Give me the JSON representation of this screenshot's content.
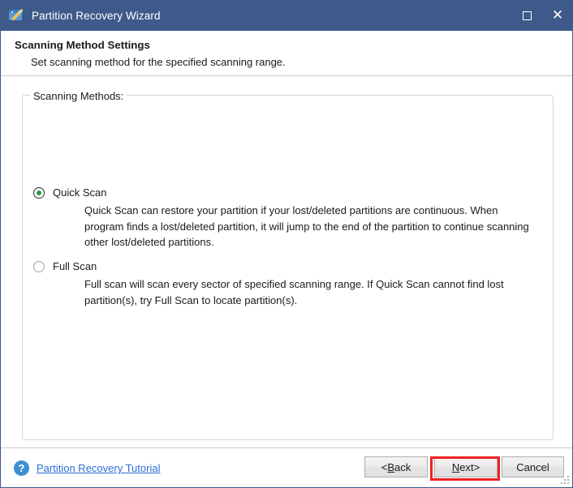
{
  "window": {
    "title": "Partition Recovery Wizard",
    "app_icon": "wizard-wand-icon",
    "titlebar_color": "#3d5a8a",
    "controls": {
      "maximize_label": "Maximize",
      "close_label": "Close"
    }
  },
  "header": {
    "title": "Scanning Method Settings",
    "subtitle": "Set scanning method for the specified scanning range."
  },
  "group": {
    "legend": "Scanning Methods:",
    "options": [
      {
        "label": "Quick Scan",
        "selected": true,
        "description": "Quick Scan can restore your partition if your lost/deleted partitions are continuous. When program finds a lost/deleted partition, it will jump to the end of the partition to continue scanning other lost/deleted partitions."
      },
      {
        "label": "Full Scan",
        "selected": false,
        "description": "Full scan will scan every sector of specified scanning range. If Quick Scan cannot find lost partition(s), try Full Scan to locate partition(s)."
      }
    ],
    "selected_accent_color": "#23a03c"
  },
  "footer": {
    "help_icon": "question-mark-icon",
    "tutorial_link": "Partition Recovery Tutorial",
    "link_color": "#2a6fd6",
    "buttons": {
      "back": {
        "prefix": "< ",
        "accel": "B",
        "rest": "ack"
      },
      "next": {
        "accel": "N",
        "rest": "ext",
        "suffix": " >",
        "highlighted": true,
        "highlight_color": "#ee2222"
      },
      "cancel": {
        "label": "Cancel"
      }
    }
  }
}
